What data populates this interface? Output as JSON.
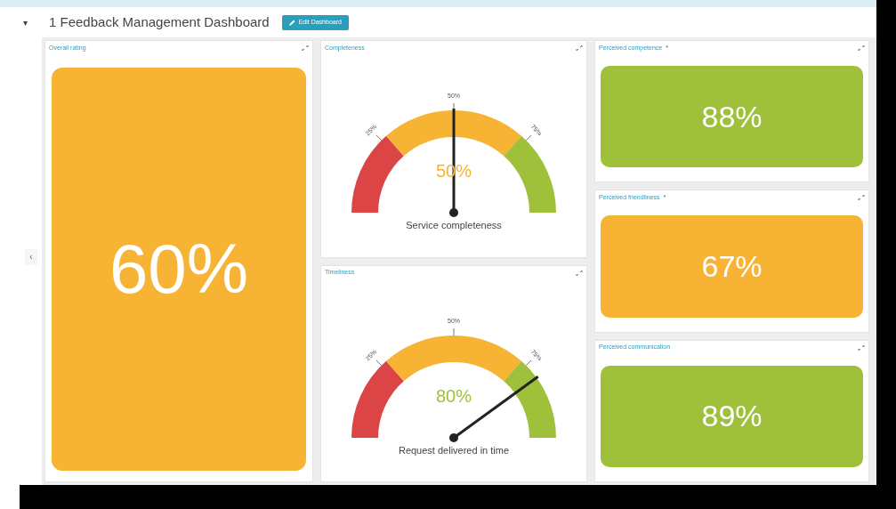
{
  "header": {
    "caret": "▾",
    "title": "1 Feedback Management Dashboard",
    "edit_button": "Edit Dashboard"
  },
  "side_toggle": "‹",
  "overall": {
    "title": "Overall rating",
    "value": "60%",
    "color": "#f7b334"
  },
  "gauges": [
    {
      "title": "Completeness",
      "value": "50%",
      "color": "#f7b334",
      "level": 0.5,
      "caption": "Service completeness",
      "ticks": [
        "25%",
        "50%",
        "75%"
      ]
    },
    {
      "title": "Timeliness",
      "value": "80%",
      "color": "#9fc03b",
      "level": 0.8,
      "caption": "Request delivered in time",
      "ticks": [
        "25%",
        "50%",
        "75%"
      ]
    }
  ],
  "tiles": [
    {
      "title": "Perceived competence",
      "mark": "*",
      "value": "88%",
      "color": "#9fc03b"
    },
    {
      "title": "Perceived friendliness",
      "mark": "*",
      "value": "67%",
      "color": "#f7b334"
    },
    {
      "title": "Perceived communication",
      "value": "89%",
      "color": "#9fc03b"
    }
  ]
}
